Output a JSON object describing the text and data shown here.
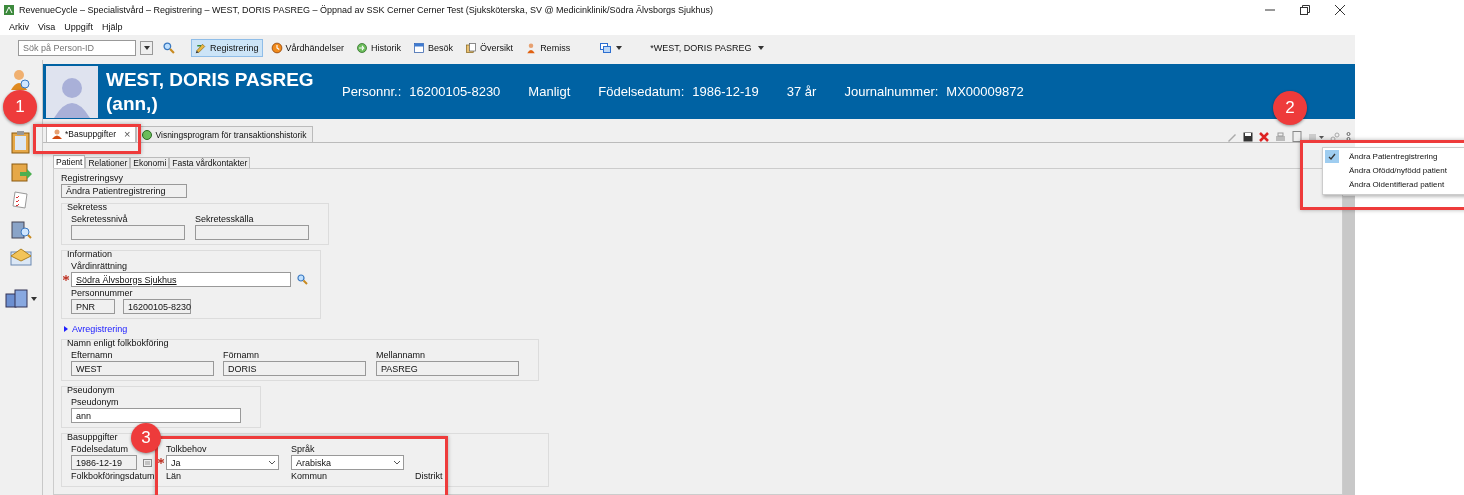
{
  "window": {
    "title": "RevenueCycle – Specialistvård – Registrering – WEST, DORIS PASREG – Öppnad av SSK Cerner Cerner Test (Sjuksköterska, SV @ Medicinklinik/Södra Älvsborgs Sjukhus)"
  },
  "menu": [
    "Arkiv",
    "Visa",
    "Uppgift",
    "Hjälp"
  ],
  "toolbar": {
    "search": {
      "placeholder": "Sök på Person-ID"
    },
    "buttons": [
      {
        "label": "Registrering",
        "selected": true
      },
      {
        "label": "Vårdhändelser",
        "selected": false
      },
      {
        "label": "Historik",
        "selected": false
      },
      {
        "label": "Besök",
        "selected": false
      },
      {
        "label": "Översikt",
        "selected": false
      },
      {
        "label": "Remiss",
        "selected": false
      }
    ],
    "patient": "*WEST, DORIS PASREG"
  },
  "banner": {
    "name": "WEST, DORIS PASREG",
    "alias": "(ann,)",
    "fields": [
      {
        "label": "Personnr.:",
        "value": "16200105-8230"
      },
      {
        "value": "Manligt"
      },
      {
        "label": "Födelsedatum:",
        "value": "1986-12-19"
      },
      {
        "value": "37 år"
      },
      {
        "label": "Journalnummer:",
        "value": "MX00009872"
      }
    ]
  },
  "tabs": [
    {
      "label": "*Basuppgifter",
      "close": "×",
      "selected": true
    },
    {
      "label": "Visningsprogram för transaktionshistorik",
      "selected": false
    }
  ],
  "subtabs": [
    {
      "label": "Patient",
      "selected": true
    },
    {
      "label": "Relationer",
      "selected": false
    },
    {
      "label": "Ekonomi",
      "selected": false
    },
    {
      "label": "Fasta vårdkontakter",
      "selected": false
    }
  ],
  "form": {
    "view": {
      "label": "Registreringsvy",
      "value": "Ändra Patientregistrering"
    },
    "sections": [
      {
        "kind": "group",
        "title": "Sekretess",
        "rows": [
          [
            {
              "label": "Sekretessnivå",
              "kind": "readonly",
              "required": false
            },
            {
              "label": "Sekretesskälla",
              "kind": "readonly",
              "required": false
            }
          ]
        ]
      },
      {
        "kind": "group",
        "title": "Information",
        "rows": [
          [
            {
              "label": "Vårdinrättning",
              "kind": "lookup",
              "value": "Södra Älvsborgs Sjukhus",
              "required": true
            }
          ],
          [
            {
              "label": "Personnummer",
              "kind": "readonly",
              "value": "PNR",
              "required": false
            },
            {
              "kind": "readonly",
              "value": "16200105-8230",
              "required": false
            }
          ]
        ]
      },
      {
        "kind": "expander",
        "title": "Avregistrering"
      },
      {
        "kind": "group",
        "title": "Namn enligt folkbokföring",
        "rows": [
          [
            {
              "label": "Efternamn",
              "kind": "readonly",
              "value": "WEST",
              "required": false
            },
            {
              "label": "Förnamn",
              "kind": "readonly",
              "value": "DORIS",
              "required": false
            },
            {
              "label": "Mellannamn",
              "kind": "readonly",
              "value": "PASREG",
              "required": false
            }
          ]
        ]
      },
      {
        "kind": "group",
        "title": "Pseudonym",
        "rows": [
          [
            {
              "label": "Pseudonym",
              "kind": "input",
              "value": "ann",
              "required": false
            }
          ]
        ]
      },
      {
        "kind": "group",
        "title": "Basuppgifter",
        "rows": [
          [
            {
              "label": "Födelsedatum",
              "kind": "date",
              "value": "1986-12-19",
              "required": false
            },
            {
              "label": "Tolkbehov",
              "kind": "select",
              "value": "Ja",
              "required": true
            },
            {
              "label": "Språk",
              "kind": "select",
              "value": "Arabiska",
              "required": false
            }
          ],
          [
            {
              "label": "Folkbokföringsdatum",
              "kind": "cut",
              "required": false
            },
            {
              "label": "Län",
              "kind": "cut",
              "required": false
            },
            {
              "label": "Kommun",
              "kind": "cut",
              "required": false
            },
            {
              "label": "Distrikt",
              "kind": "cut",
              "required": false
            }
          ]
        ]
      }
    ]
  },
  "popup_menu": [
    {
      "label": "Ändra Patientregistrering",
      "checked": true
    },
    {
      "label": "Ändra Ofödd/nyfödd patient",
      "checked": false
    },
    {
      "label": "Ändra Oidentifierad patient",
      "checked": false
    }
  ],
  "callouts": [
    "1",
    "2",
    "3"
  ]
}
